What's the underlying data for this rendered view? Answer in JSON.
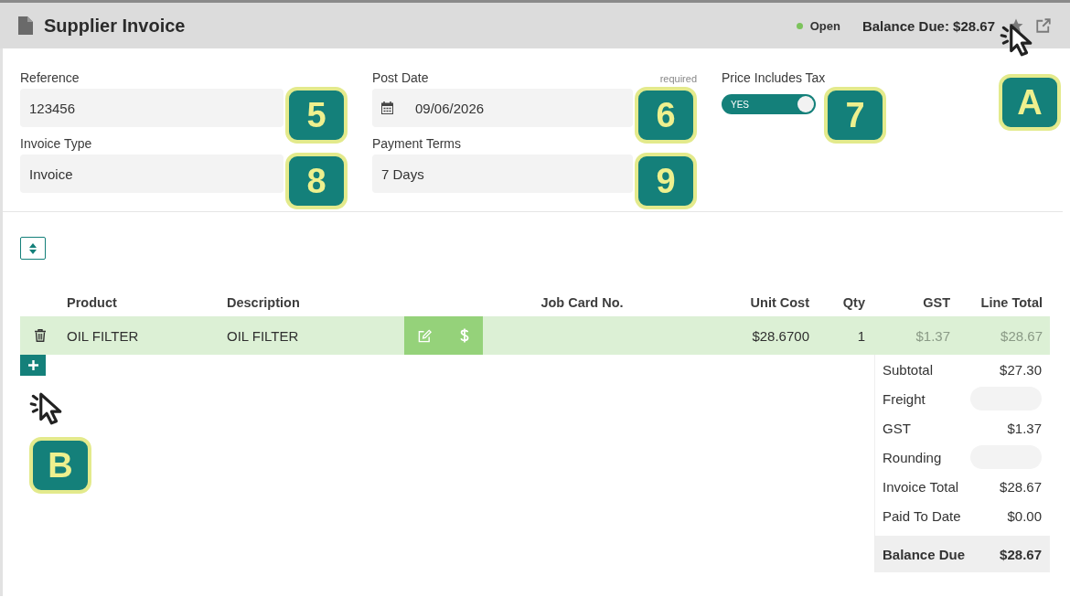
{
  "header": {
    "title": "Supplier Invoice",
    "status": {
      "label": "Open",
      "color": "#7cc35c"
    },
    "balance": "Balance Due: $28.67",
    "callout": "A"
  },
  "form": {
    "fields": [
      {
        "kind": "text",
        "label": "Reference",
        "value": "123456",
        "callout": "5"
      },
      {
        "kind": "date",
        "label": "Post Date",
        "hint": "required",
        "value": "09/06/2026",
        "callout": "6"
      },
      {
        "kind": "toggle",
        "label": "Price Includes Tax",
        "value": "YES",
        "on": true,
        "callout": "7"
      },
      {
        "kind": "select",
        "label": "Invoice Type",
        "value": "Invoice",
        "callout": "8"
      },
      {
        "kind": "select",
        "label": "Payment Terms",
        "value": "7 Days",
        "callout": "9"
      }
    ]
  },
  "table": {
    "columns": [
      "Product",
      "Description",
      "Job Card No.",
      "Unit Cost",
      "Qty",
      "GST",
      "Line Total"
    ],
    "rows": [
      {
        "product": "OIL FILTER",
        "description": "OIL FILTER",
        "job_card": "",
        "unit_cost": "$28.6700",
        "qty": "1",
        "gst": "$1.37",
        "line_total": "$28.67"
      }
    ],
    "add_callout": "B"
  },
  "totals": [
    {
      "kind": "text",
      "label": "Subtotal",
      "value": "$27.30"
    },
    {
      "kind": "field",
      "label": "Freight"
    },
    {
      "kind": "text",
      "label": "GST",
      "value": "$1.37"
    },
    {
      "kind": "field",
      "label": "Rounding"
    },
    {
      "kind": "text",
      "label": "Invoice Total",
      "value": "$28.67"
    },
    {
      "kind": "text",
      "label": "Paid To Date",
      "value": "$0.00"
    },
    {
      "kind": "total",
      "label": "Balance Due",
      "value": "$28.67"
    }
  ]
}
